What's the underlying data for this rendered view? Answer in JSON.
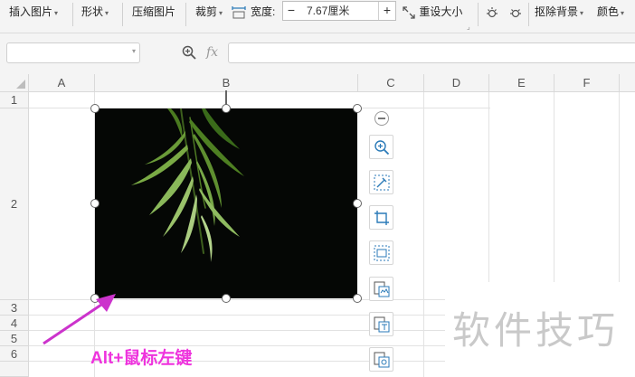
{
  "ribbon": {
    "insert_picture": "插入图片",
    "shape": "形状",
    "compress": "压缩图片",
    "crop": "裁剪",
    "width_label": "宽度:",
    "width_value": "7.67厘米",
    "minus": "−",
    "plus": "+",
    "reset_size": "重设大小",
    "remove_bg": "抠除背景",
    "color": "颜色"
  },
  "formula_bar": {
    "fx": "fx"
  },
  "columns": [
    "A",
    "B",
    "C",
    "D",
    "E",
    "F"
  ],
  "rows": [
    "1",
    "2",
    "3",
    "4",
    "5",
    "6"
  ],
  "annotation": "Alt+鼠标左键",
  "watermark": "软件技巧",
  "colors": {
    "annotation": "#ee33dd",
    "arrow": "#cc33cc",
    "plant_green": "#5a8a2a"
  }
}
